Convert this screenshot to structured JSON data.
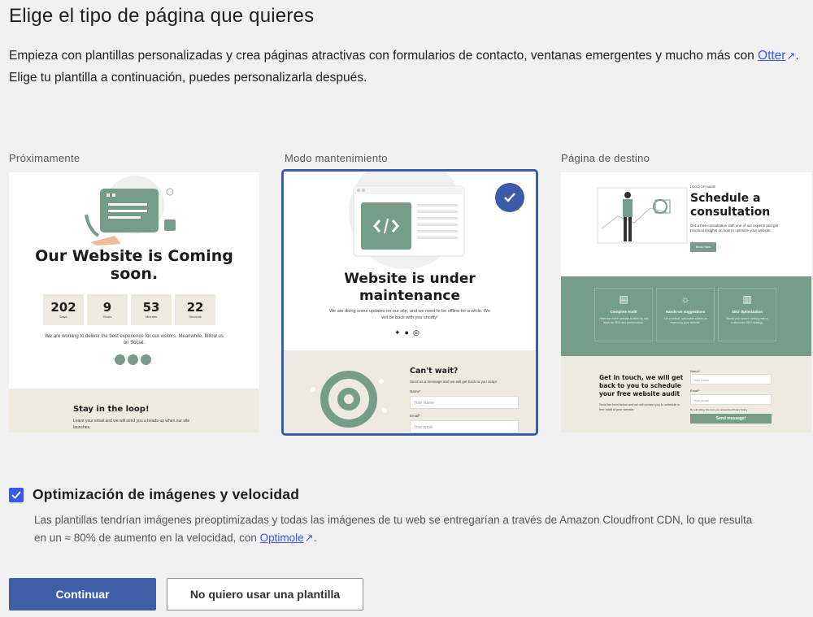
{
  "page": {
    "title": "Elige el tipo de página que quieres",
    "intro_line1": "Empieza con plantillas personalizadas y crea páginas atractivas con formularios de contacto, ventanas emergentes y mucho más con",
    "intro_link": "Otter",
    "intro_after_link": ".",
    "intro_line2": "Elige tu plantilla a continuación, puedes personalizarla después."
  },
  "templates": [
    {
      "label": "Próximamente",
      "heading": "Our Website is Coming soon.",
      "counters": [
        {
          "value": "202",
          "unit": "Days"
        },
        {
          "value": "9",
          "unit": "Hours"
        },
        {
          "value": "53",
          "unit": "Minutes"
        },
        {
          "value": "22",
          "unit": "Seconds"
        }
      ],
      "message": "We are working to deliver the best experience for our visitors. Meanwhile, follow us on Social.",
      "footer_title": "Stay in the loop!",
      "footer_text": "Leave your email and we will send you a heads-up when our site launches."
    },
    {
      "label": "Modo mantenimiento",
      "heading": "Website is under maintenance",
      "message": "We are doing some updates on our site, and we need to be offline for a while. We will be back with you shortly!",
      "form_title": "Can't wait?",
      "form_text": "Send us a message and we will get back to you asap!",
      "field1_label": "Name*",
      "field1_placeholder": "Your Name",
      "field2_label": "Email*",
      "field2_placeholder": "Your email",
      "selected": true
    },
    {
      "label": "Página de destino",
      "eyebrow": "LOGO OR NAME",
      "heading": "Schedule a consultation",
      "intro": "Get a free consultation with one of our experts and get practical insights on how to optimize your website.",
      "cta": "Book Now",
      "features": [
        {
          "title": "Complete Audit",
          "text": "Have the entire website audited by our team for SEO and performance."
        },
        {
          "title": "Hands-on suggestions",
          "text": "Get practical, actionable advice on improving your website."
        },
        {
          "title": "SEO Optimization",
          "text": "Boost your search ranking with a customized SEO strategy."
        }
      ],
      "contact_title": "Get in touch, we will get back to you to schedule your free website audit",
      "contact_text": "Send the form below and we will contact you to schedule a free audit of your website.",
      "name_label": "Name*",
      "name_placeholder": "Your name",
      "email_label": "Email*",
      "email_placeholder": "Your email",
      "consent_text": "By submitting this form you accept the Privacy Policy",
      "submit": "Send message!"
    }
  ],
  "optimization": {
    "checked": true,
    "title": "Optimización de imágenes y velocidad",
    "description": "Las plantillas tendrían imágenes preoptimizadas y todas las imágenes de tu web se entregarían a través de Amazon Cloudfront CDN, lo que resulta en un ≈ 80% de aumento en la velocidad, con",
    "link": "Optimole",
    "after_link": "."
  },
  "buttons": {
    "continue": "Continuar",
    "skip": "No quiero usar una plantilla"
  },
  "colors": {
    "accent": "#3c5ba8",
    "template_green": "#759d8a",
    "link": "#3858e9"
  }
}
